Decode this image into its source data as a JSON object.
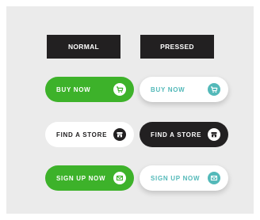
{
  "headers": {
    "normal": "NORMAL",
    "pressed": "PRESSED"
  },
  "buttons": {
    "buy_now_normal": {
      "label": "BUY NOW",
      "icon": "cart-icon"
    },
    "buy_now_pressed": {
      "label": "BUY NOW",
      "icon": "cart-icon"
    },
    "find_store_normal": {
      "label": "FIND A STORE",
      "icon": "store-icon"
    },
    "find_store_pressed": {
      "label": "FIND A STORE",
      "icon": "store-icon"
    },
    "sign_up_normal": {
      "label": "SIGN UP NOW",
      "icon": "mail-icon"
    },
    "sign_up_pressed": {
      "label": "SIGN UP NOW",
      "icon": "mail-icon"
    }
  },
  "colors": {
    "background": "#ebebeb",
    "dark": "#222021",
    "green": "#3db22a",
    "teal": "#53b9b9",
    "white": "#ffffff"
  }
}
